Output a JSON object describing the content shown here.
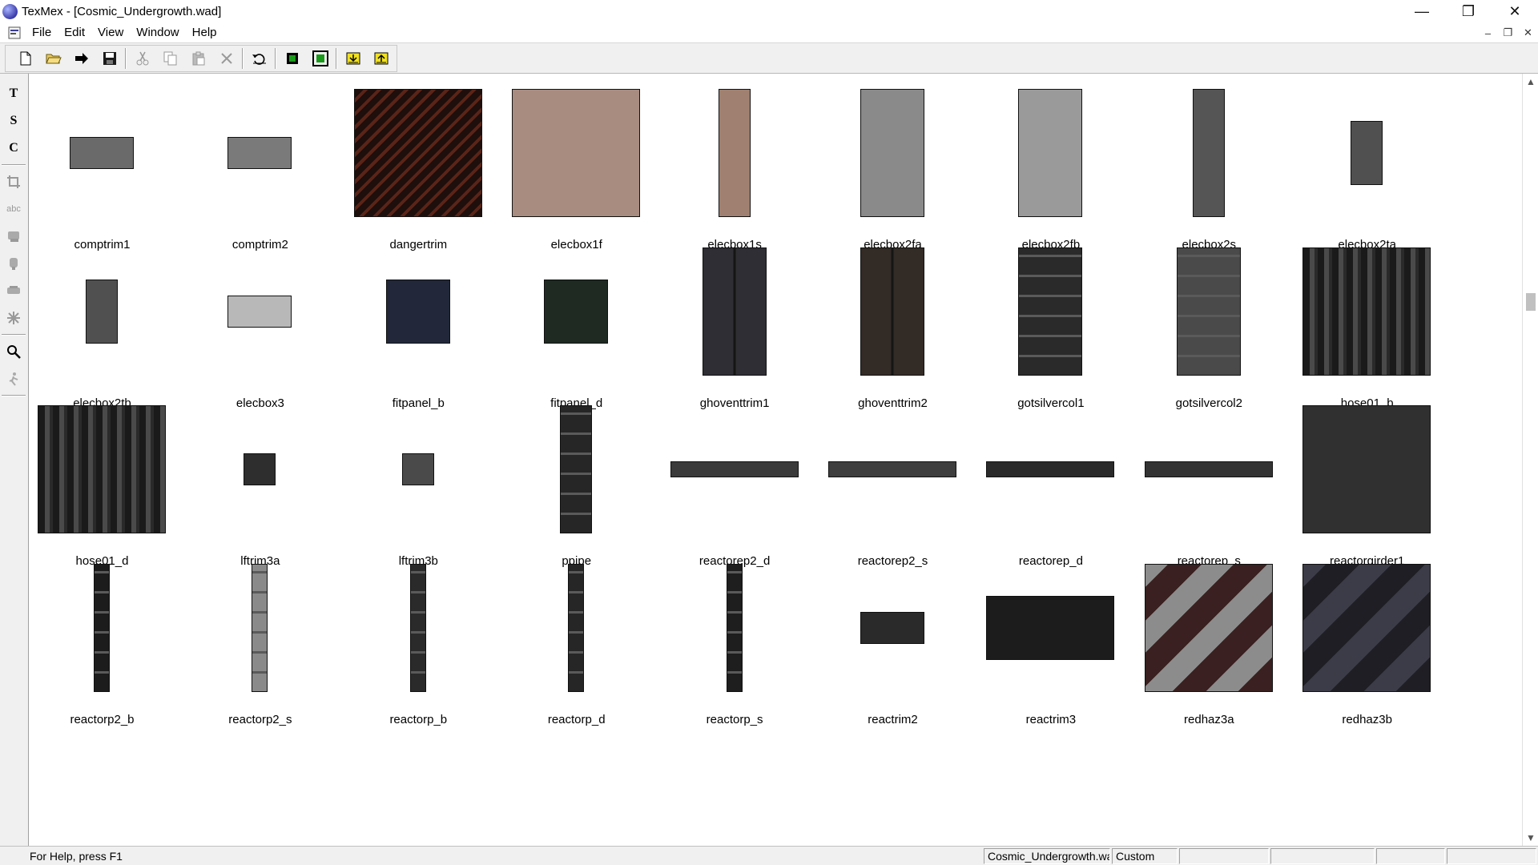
{
  "window": {
    "title": "TexMex - [Cosmic_Undergrowth.wad]",
    "controls": [
      "minimize",
      "restore",
      "close"
    ]
  },
  "menu": {
    "items": [
      "File",
      "Edit",
      "View",
      "Window",
      "Help"
    ]
  },
  "toolbar": {
    "buttons": [
      "new-document-icon",
      "open-folder-icon",
      "forward-arrow-icon",
      "save-disk-icon",
      "cut-icon",
      "copy-icon",
      "paste-icon",
      "delete-icon",
      "undo-icon",
      "fit-green-icon",
      "fit-frame-icon",
      "import-yellow-icon",
      "export-yellow-icon"
    ]
  },
  "palette": {
    "tools": [
      "text-t-icon",
      "text-s-icon",
      "text-c-icon",
      "crop-icon",
      "abc-icon",
      "stamp-icon",
      "paint-icon",
      "eraser-icon",
      "sparkle-icon",
      "zoom-icon",
      "runner-icon"
    ]
  },
  "textures": [
    {
      "name": "comptrim1",
      "color": "#6a6a6a"
    },
    {
      "name": "comptrim2",
      "color": "#7a7a7a"
    },
    {
      "name": "dangertrim",
      "color": "#2a1210"
    },
    {
      "name": "elecbox1f",
      "color": "#a88c80"
    },
    {
      "name": "elecbox1s",
      "color": "#a08070"
    },
    {
      "name": "elecbox2fa",
      "color": "#8a8a8a"
    },
    {
      "name": "elecbox2fb",
      "color": "#9a9a9a"
    },
    {
      "name": "elecbox2s",
      "color": "#555555"
    },
    {
      "name": "elecbox2ta",
      "color": "#505050"
    },
    {
      "name": "elecbox2tb",
      "color": "#505050"
    },
    {
      "name": "elecbox3",
      "color": "#b8b8b8"
    },
    {
      "name": "fitpanel_b",
      "color": "#22283a"
    },
    {
      "name": "fitpanel_d",
      "color": "#1e2a22"
    },
    {
      "name": "ghoventtrim1",
      "color": "#2e2e34"
    },
    {
      "name": "ghoventtrim2",
      "color": "#332b26"
    },
    {
      "name": "gotsilvercol1",
      "color": "#2a2a2a"
    },
    {
      "name": "gotsilvercol2",
      "color": "#4a4a4a"
    },
    {
      "name": "hose01_b",
      "color": "#2c2a28"
    },
    {
      "name": "hose01_d",
      "color": "#262626"
    },
    {
      "name": "lftrim3a",
      "color": "#2e2e2e"
    },
    {
      "name": "lftrim3b",
      "color": "#4a4a4a"
    },
    {
      "name": "ppipe",
      "color": "#262626"
    },
    {
      "name": "reactorep2_d",
      "color": "#3a3a3a"
    },
    {
      "name": "reactorep2_s",
      "color": "#3e3e3e"
    },
    {
      "name": "reactorep_d",
      "color": "#2a2a2a"
    },
    {
      "name": "reactorep_s",
      "color": "#333333"
    },
    {
      "name": "reactorgirder1",
      "color": "#303030"
    },
    {
      "name": "reactorp2_b",
      "color": "#1c1c1c"
    },
    {
      "name": "reactorp2_s",
      "color": "#8a8a8a"
    },
    {
      "name": "reactorp_b",
      "color": "#2a2a2a"
    },
    {
      "name": "reactorp_d",
      "color": "#262626"
    },
    {
      "name": "reactorp_s",
      "color": "#1e1e1e"
    },
    {
      "name": "reactrim2",
      "color": "#2a2a2a"
    },
    {
      "name": "reactrim3",
      "color": "#1c1c1c"
    },
    {
      "name": "redhaz3a",
      "color": "#3a2020"
    },
    {
      "name": "redhaz3b",
      "color": "#1e1e24"
    }
  ],
  "status": {
    "help": "For Help, press F1",
    "panes": [
      "Cosmic_Undergrowth.wad",
      "Custom",
      "",
      "",
      "",
      ""
    ]
  }
}
